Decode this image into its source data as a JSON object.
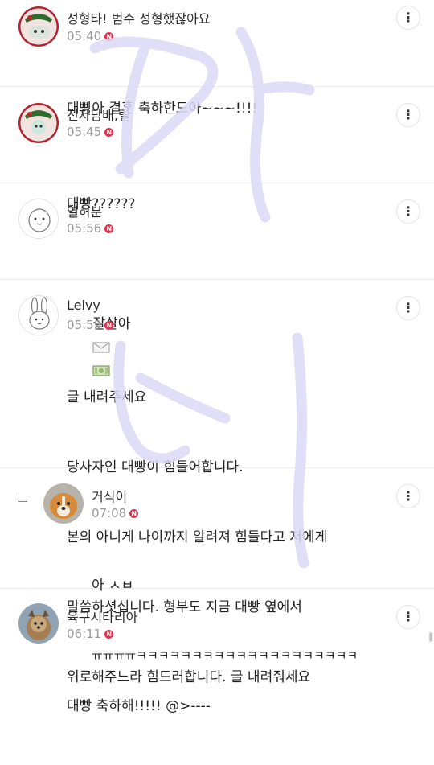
{
  "comments": [
    {
      "nickname": "성형타! 범수 성형했잖아요",
      "time": "05:40",
      "lines": [
        "대빵아 결혼 축하한드아~~~!!!!"
      ]
    },
    {
      "nickname": "전자담배,릴",
      "time": "05:45",
      "lines": [
        "대빵??????"
      ]
    },
    {
      "nickname": "열허분",
      "time": "05:56",
      "lines": [
        "잘살아"
      ],
      "emoji": [
        "envelope-emoji",
        "money-emoji"
      ]
    },
    {
      "nickname": "Leivy",
      "time": "05:59",
      "lines": [
        "글 내려주세요",
        "당사자인 대빵이 힘들어합니다.",
        "본의 아니게 나이까지 알려져 힘들다고 저에게",
        "말씀하셧섭니다. 형부도 지금 대빵 옆에서",
        "위로해주느라 힘드러합니다. 글 내려줘세요"
      ]
    },
    {
      "nickname": "거식이",
      "time": "07:08",
      "reply": true,
      "lines": [
        "아 ㅅㅂ",
        "ㅠㅠㅠㅠㅋㅋㅋㅋㅋㅋㅋㅋㅋㅋㅋㅋㅋㅋㅋㅋㅋㅋㅋㅋ"
      ]
    },
    {
      "nickname": "육구시타리아",
      "time": "06:11",
      "lines": [
        "대빵 축하해!!!!! @>----"
      ]
    }
  ],
  "badge_label": "N",
  "more_icon": "⋮",
  "colors": {
    "watermark": "#dcd9f7",
    "new_badge": "#e8304a"
  }
}
